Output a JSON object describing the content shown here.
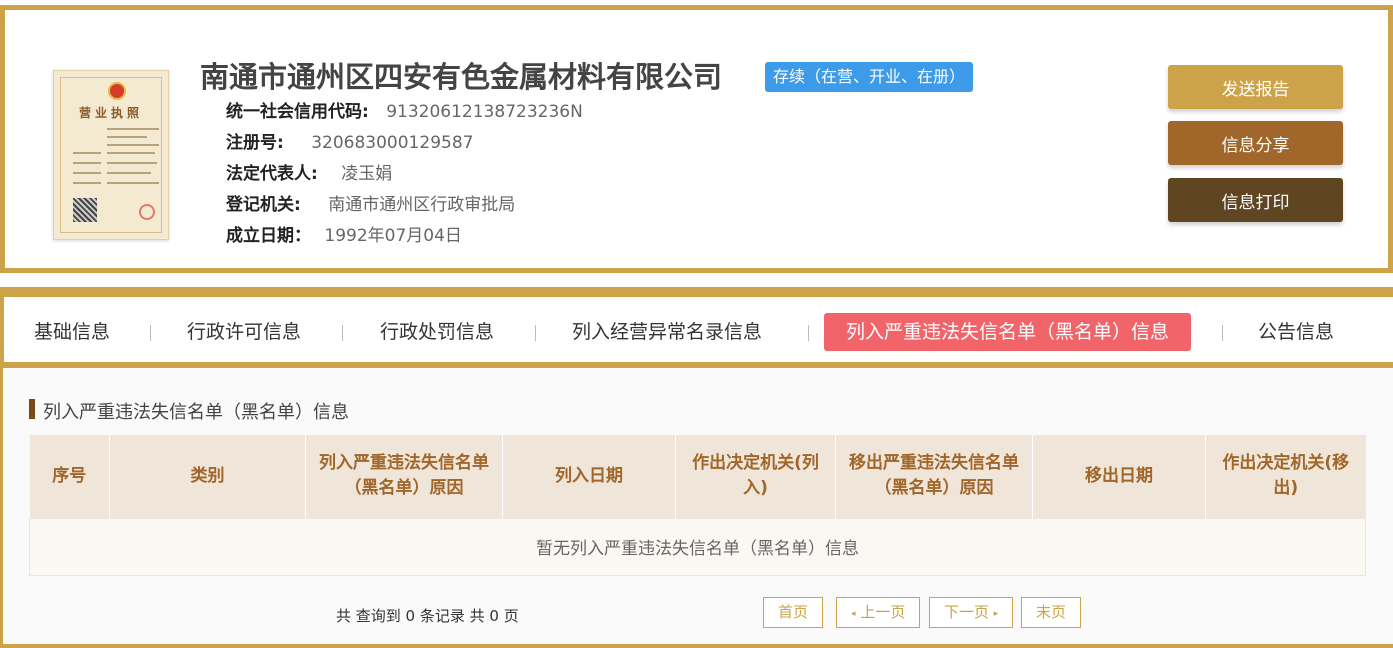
{
  "company": {
    "name": "南通市通州区四安有色金属材料有限公司",
    "status": "存续（在营、开业、在册）",
    "license_title": "营业执照",
    "info": [
      {
        "label": "统一社会信用代码:",
        "value": "91320612138723236N"
      },
      {
        "label": "注册号:",
        "value": "320683000129587"
      },
      {
        "label": "法定代表人:",
        "value": "凌玉娟"
      },
      {
        "label": "登记机关:",
        "value": "南通市通州区行政审批局"
      },
      {
        "label": "成立日期：",
        "value": "1992年07月04日"
      }
    ]
  },
  "actions": {
    "send": "发送报告",
    "share": "信息分享",
    "print": "信息打印"
  },
  "tabs": [
    {
      "label": "基础信息",
      "active": false
    },
    {
      "label": "行政许可信息",
      "active": false
    },
    {
      "label": "行政处罚信息",
      "active": false
    },
    {
      "label": "列入经营异常名录信息",
      "active": false
    },
    {
      "label": "列入严重违法失信名单（黑名单）信息",
      "active": true
    },
    {
      "label": "公告信息",
      "active": false
    }
  ],
  "section": {
    "title": "列入严重违法失信名单（黑名单）信息",
    "columns": [
      "序号",
      "类别",
      "列入严重违法失信名单（黑名单）原因",
      "列入日期",
      "作出决定机关(列入)",
      "移出严重违法失信名单（黑名单）原因",
      "移出日期",
      "作出决定机关(移出)"
    ],
    "empty_message": "暂无列入严重违法失信名单（黑名单）信息"
  },
  "pagination": {
    "summary": "共 查询到 0 条记录 共 0 页",
    "first": "首页",
    "prev": "上一页",
    "next": "下一页",
    "last": "末页"
  },
  "colors": {
    "accent": "#cda349",
    "active_tab": "#f0646a",
    "status_badge": "#3d9be9",
    "share_button": "#a0662a",
    "print_button": "#5f4521"
  }
}
